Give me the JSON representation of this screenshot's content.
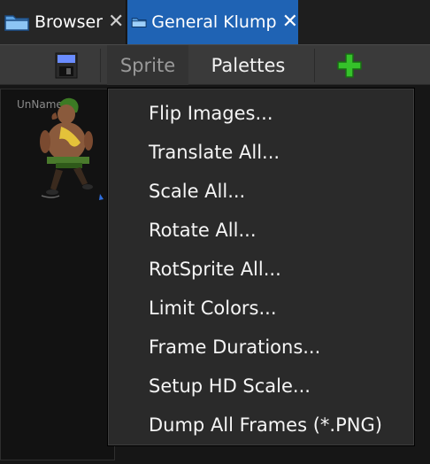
{
  "tabs": [
    {
      "label": "Browser",
      "close": "✕",
      "active": false
    },
    {
      "label": "General Klump",
      "close": "✕",
      "active": true
    }
  ],
  "toolbar": {
    "sprite_label": "Sprite",
    "palettes_label": "Palettes"
  },
  "frames": {
    "item_name": "UnNamed"
  },
  "menu": {
    "items": [
      {
        "label": "Flip Images..."
      },
      {
        "label": "Translate All..."
      },
      {
        "label": "Scale All..."
      },
      {
        "label": "Rotate All..."
      },
      {
        "label": "RotSprite All..."
      },
      {
        "label": "Limit Colors..."
      },
      {
        "label": "Frame Durations..."
      },
      {
        "label": "Setup HD Scale..."
      },
      {
        "label": "Dump All Frames (*.PNG)"
      }
    ]
  },
  "colors": {
    "active_tab": "#1f63b4",
    "add_icon": "#35c22a",
    "menu_bg": "#2a2a2a"
  },
  "icons": {
    "tab": "folder-icon",
    "save": "floppy-disk-icon",
    "add": "plus-icon"
  }
}
